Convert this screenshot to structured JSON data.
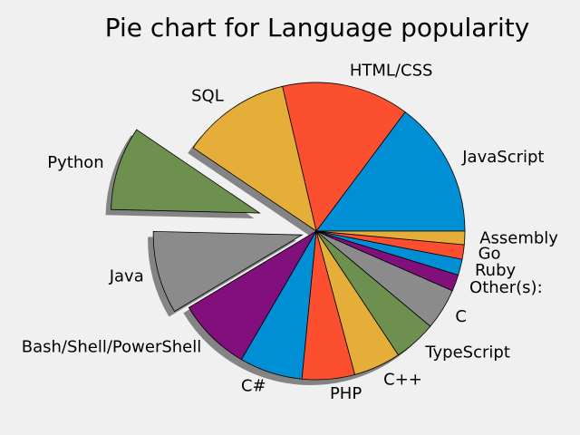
{
  "chart_data": {
    "type": "pie",
    "title": "Pie chart for Language popularity",
    "start_angle_deg": 0,
    "direction": "counterclockwise",
    "shadow": true,
    "slices": [
      {
        "label": "JavaScript",
        "value": 67.8,
        "color": "#008fd5",
        "explode": 0
      },
      {
        "label": "HTML/CSS",
        "value": 63.5,
        "color": "#fc4f30",
        "explode": 0
      },
      {
        "label": "SQL",
        "value": 54.4,
        "color": "#e5ae38",
        "explode": 0
      },
      {
        "label": "Python",
        "value": 41.7,
        "color": "#6d904f",
        "explode": 0.4
      },
      {
        "label": "Java",
        "value": 41.1,
        "color": "#8b8b8b",
        "explode": 0.1
      },
      {
        "label": "Bash/Shell/PowerShell",
        "value": 36.7,
        "color": "#810f7c",
        "explode": 0
      },
      {
        "label": "C#",
        "value": 31.4,
        "color": "#008fd5",
        "explode": 0
      },
      {
        "label": "PHP",
        "value": 26.2,
        "color": "#fc4f30",
        "explode": 0
      },
      {
        "label": "C++",
        "value": 23.5,
        "color": "#e5ae38",
        "explode": 0
      },
      {
        "label": "TypeScript",
        "value": 21.2,
        "color": "#6d904f",
        "explode": 0
      },
      {
        "label": "C",
        "value": 20.6,
        "color": "#8b8b8b",
        "explode": 0
      },
      {
        "label": "Other(s):",
        "value": 8.2,
        "color": "#810f7c",
        "explode": 0
      },
      {
        "label": "Ruby",
        "value": 8.0,
        "color": "#008fd5",
        "explode": 0
      },
      {
        "label": "Go",
        "value": 7.2,
        "color": "#fc4f30",
        "explode": 0
      },
      {
        "label": "Assembly",
        "value": 6.7,
        "color": "#e5ae38",
        "explode": 0
      }
    ]
  }
}
